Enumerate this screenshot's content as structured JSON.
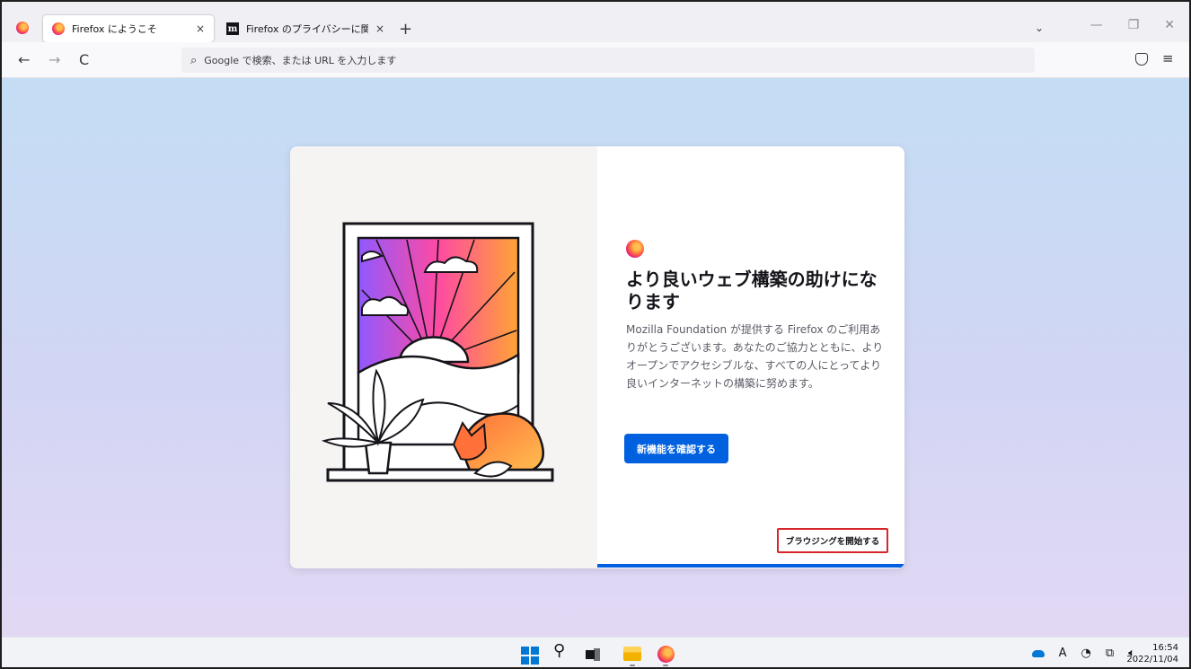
{
  "browser": {
    "tabs": [
      {
        "label": "Firefox にようこそ",
        "close": "×",
        "active": true
      },
      {
        "label": "Firefox のプライバシーに関する通知",
        "close": "×",
        "active": false
      }
    ],
    "new_tab": "+",
    "tab_list": "⌄",
    "window_controls": {
      "minimize": "—",
      "restore": "❐",
      "close": "✕"
    }
  },
  "nav": {
    "back": "←",
    "forward": "→",
    "reload": "C",
    "url_placeholder": "Google で検索、または URL を入力します",
    "menu": "≡"
  },
  "welcome": {
    "headline": "より良いウェブ構築の助けになります",
    "body": "Mozilla Foundation が提供する Firefox のご利用ありがとうございます。あなたのご協力とともに、よりオープンでアクセシブルな、すべての人にとってより良いインターネットの構築に努めます。",
    "primary_button": "新機能を確認する",
    "secondary_button": "ブラウジングを開始する",
    "progress_fraction": 0.5
  },
  "taskbar": {
    "search_glyph": "⚲",
    "tray_ime": "A",
    "tray_clock_glyph": "◔",
    "tray_display_glyph": "⧉",
    "tray_volume_glyph": "🔈︎",
    "time": "16:54",
    "date": "2022/11/04"
  },
  "colors": {
    "accent": "#0061e0",
    "highlight_border": "#d7262b"
  }
}
